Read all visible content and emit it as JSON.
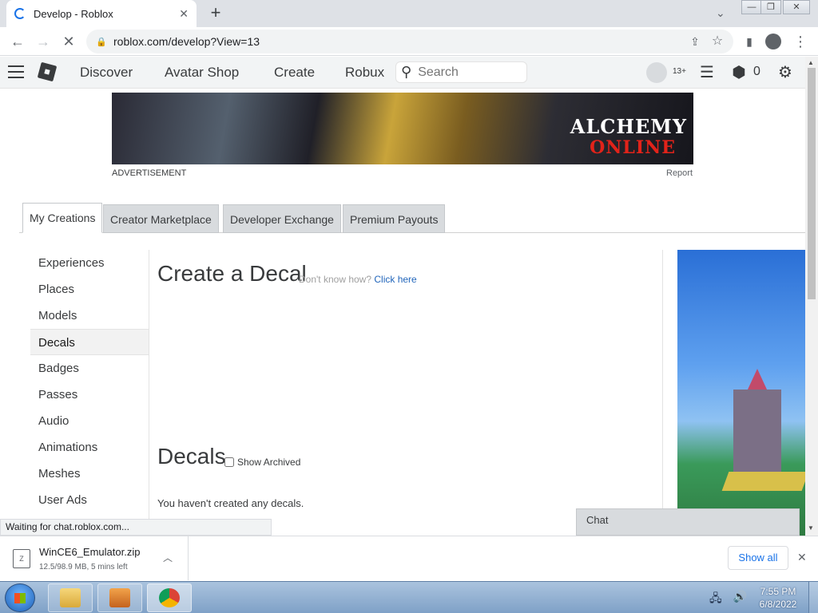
{
  "browser": {
    "tab_title": "Develop - Roblox",
    "url": "roblox.com/develop?View=13"
  },
  "roblox_header": {
    "nav": [
      "Discover",
      "Avatar Shop",
      "Create",
      "Robux"
    ],
    "search_placeholder": "Search",
    "age_tag": "13+",
    "robux_balance": "0"
  },
  "ad": {
    "top_banner_line1": "ALCHEMY",
    "top_banner_line2": "ONLINE",
    "label": "ADVERTISEMENT",
    "report": "Report"
  },
  "dev_tabs": [
    {
      "label": "My Creations",
      "active": true
    },
    {
      "label": "Creator Marketplace",
      "active": false
    },
    {
      "label": "Developer Exchange",
      "active": false
    },
    {
      "label": "Premium Payouts",
      "active": false
    }
  ],
  "sidebar": {
    "items": [
      {
        "label": "Experiences"
      },
      {
        "label": "Places"
      },
      {
        "label": "Models"
      },
      {
        "label": "Decals",
        "active": true
      },
      {
        "label": "Badges"
      },
      {
        "label": "Passes"
      },
      {
        "label": "Audio"
      },
      {
        "label": "Animations"
      },
      {
        "label": "Meshes"
      },
      {
        "label": "User Ads"
      }
    ]
  },
  "main": {
    "create_title": "Create a Decal",
    "hint_text": "Don't know how?",
    "hint_link": "Click here",
    "section_title": "Decals",
    "show_archived_label": "Show Archived",
    "empty_message": "You haven't created any decals."
  },
  "chat": {
    "label": "Chat"
  },
  "status_bar": {
    "text": "Waiting for chat.roblox.com..."
  },
  "download": {
    "filename": "WinCE6_Emulator.zip",
    "progress": "12.5/98.9 MB, 5 mins left",
    "show_all": "Show all"
  },
  "taskbar": {
    "time": "7:55 PM",
    "date": "6/8/2022"
  },
  "colors": {
    "chrome_bg": "#dee1e6",
    "roblox_header_bg": "#f2f4f5",
    "link_blue": "#2266bb",
    "taskbar_blue": "#7fa1c7"
  }
}
